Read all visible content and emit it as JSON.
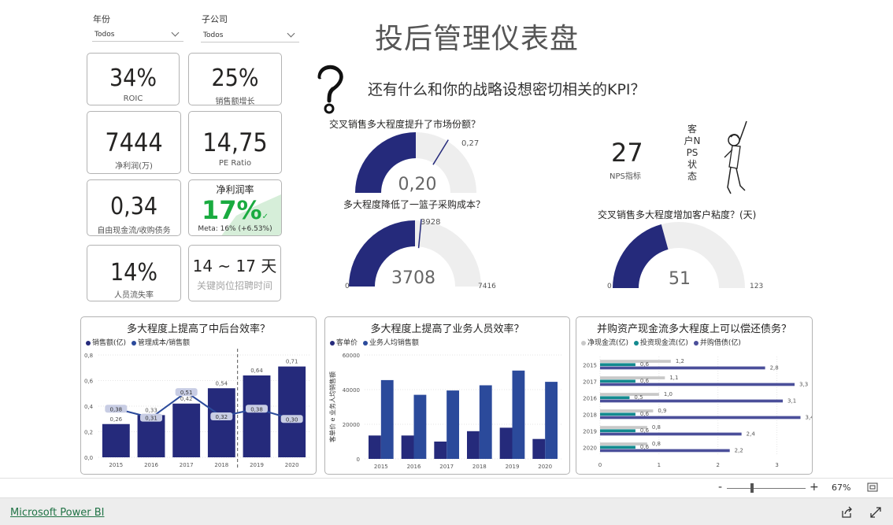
{
  "header": {
    "title": "投后管理仪表盘",
    "question": "还有什么和你的战略设想密切相关的KPI？"
  },
  "slicers": [
    {
      "label": "年份",
      "value": "Todos"
    },
    {
      "label": "子公司",
      "value": "Todos"
    }
  ],
  "cards": {
    "roic": {
      "value": "34%",
      "label": "ROIC"
    },
    "sales_growth": {
      "value": "25%",
      "label": "销售额增长"
    },
    "net_profit": {
      "value": "7444",
      "label": "净利润(万)"
    },
    "pe": {
      "value": "14,75",
      "label": "PE Ratio"
    },
    "fcf": {
      "value": "0,34",
      "label": "自由现金流/收购债务"
    },
    "margin": {
      "title": "净利润率",
      "value": "17%",
      "check": "✓",
      "meta": "Meta: 16% (+6.53%)",
      "color": "#1aab40"
    },
    "turnover": {
      "value": "14%",
      "label": "人员流失率"
    },
    "hiring": {
      "value": "14 ~ 17 天",
      "label": "关键岗位招聘时间"
    }
  },
  "nps": {
    "value": "27",
    "label": "NPS指标",
    "side_label": "客户NPS状态"
  },
  "colors": {
    "navy": "#252a7b",
    "blue": "#2b4a9b",
    "teal": "#138a8f",
    "gray": "#c8c8c8",
    "track": "#eeeeee",
    "light_slate": "#7f8ab9"
  },
  "chart_data": [
    {
      "type": "gauge",
      "title": "交叉销售多大程度提升了市场份额？",
      "value": "0,20",
      "target": "0,27",
      "value_num": 0.2,
      "target_num": 0.27,
      "min": 0,
      "max": 0.4
    },
    {
      "type": "gauge",
      "title": "多大程度降低了一篮子采购成本？",
      "value": "3708",
      "target": "3928",
      "min": "0",
      "max": "7416",
      "value_num": 3708,
      "target_num": 3928,
      "max_num": 7416
    },
    {
      "type": "gauge",
      "title": "交叉销售多大程度增加客户粘度？(天)",
      "value": "51",
      "min": "0",
      "max": "123",
      "value_num": 51,
      "max_num": 123
    },
    {
      "type": "bar",
      "title": "多大程度上提高了中后台效率？",
      "legend": [
        "销售额(亿)",
        "管理成本/销售额"
      ],
      "categories": [
        "2015",
        "2016",
        "2017",
        "2018",
        "2019",
        "2020"
      ],
      "series": [
        {
          "name": "销售额(亿)",
          "values": [
            0.26,
            0.33,
            0.42,
            0.54,
            0.64,
            0.71
          ],
          "labels": [
            "0,26",
            "0,33",
            "0,42",
            "0,54",
            "0,64",
            "0,71"
          ]
        },
        {
          "name": "管理成本/销售额",
          "values": [
            0.38,
            0.31,
            0.51,
            0.32,
            0.38,
            0.3
          ],
          "labels": [
            "0,38",
            "0,31",
            "0,51",
            "0,32",
            "0,38",
            "0,30"
          ]
        }
      ],
      "ylim": [
        0,
        0.8
      ],
      "yticks": [
        "0,0",
        "0,2",
        "0,4",
        "0,6",
        "0,8"
      ]
    },
    {
      "type": "bar",
      "title": "多大程度上提高了业务人员效率？",
      "legend": [
        "客单价",
        "业务人均销售额"
      ],
      "ylabel": "客单价 e 业务人均销售额",
      "categories": [
        "2015",
        "2016",
        "2017",
        "2018",
        "2019",
        "2020"
      ],
      "series": [
        {
          "name": "客单价",
          "values": [
            13500,
            13500,
            10000,
            16000,
            18000,
            11500
          ]
        },
        {
          "name": "业务人均销售额",
          "values": [
            45500,
            37000,
            39500,
            42500,
            51000,
            44500
          ]
        }
      ],
      "ylim": [
        0,
        60000
      ],
      "yticks": [
        "0",
        "20000",
        "40000",
        "60000"
      ]
    },
    {
      "type": "bar",
      "orientation": "horizontal",
      "title": "并购资产现金流多大程度上可以偿还债务？",
      "legend": [
        "净现金流(亿)",
        "投资现金流(亿)",
        "并购借债(亿)"
      ],
      "categories": [
        "2015",
        "2017",
        "2016",
        "2018",
        "2019",
        "2020"
      ],
      "series": [
        {
          "name": "净现金流(亿)",
          "values": [
            1.2,
            1.1,
            1.0,
            0.9,
            0.8,
            0.8
          ],
          "labels": [
            "1,2",
            "1,1",
            "1,0",
            "0,9",
            "0,8",
            "0,8"
          ]
        },
        {
          "name": "投资现金流(亿)",
          "values": [
            0.6,
            0.6,
            0.5,
            0.6,
            0.6,
            0.6
          ],
          "labels": [
            "0,6",
            "0,6",
            "0,5",
            "0,6",
            "0,6",
            "0,6"
          ]
        },
        {
          "name": "并购借债(亿)",
          "values": [
            2.8,
            3.3,
            3.1,
            3.4,
            2.4,
            2.2
          ],
          "labels": [
            "2,8",
            "3,3",
            "3,1",
            "3,4",
            "2,4",
            "2,2"
          ]
        }
      ],
      "xlim": [
        0,
        3.5
      ],
      "xticks": [
        "0",
        "1",
        "2",
        "3"
      ]
    }
  ],
  "footer": {
    "zoom": "67%",
    "brand": "Microsoft Power BI",
    "minus": "-",
    "plus": "+"
  }
}
